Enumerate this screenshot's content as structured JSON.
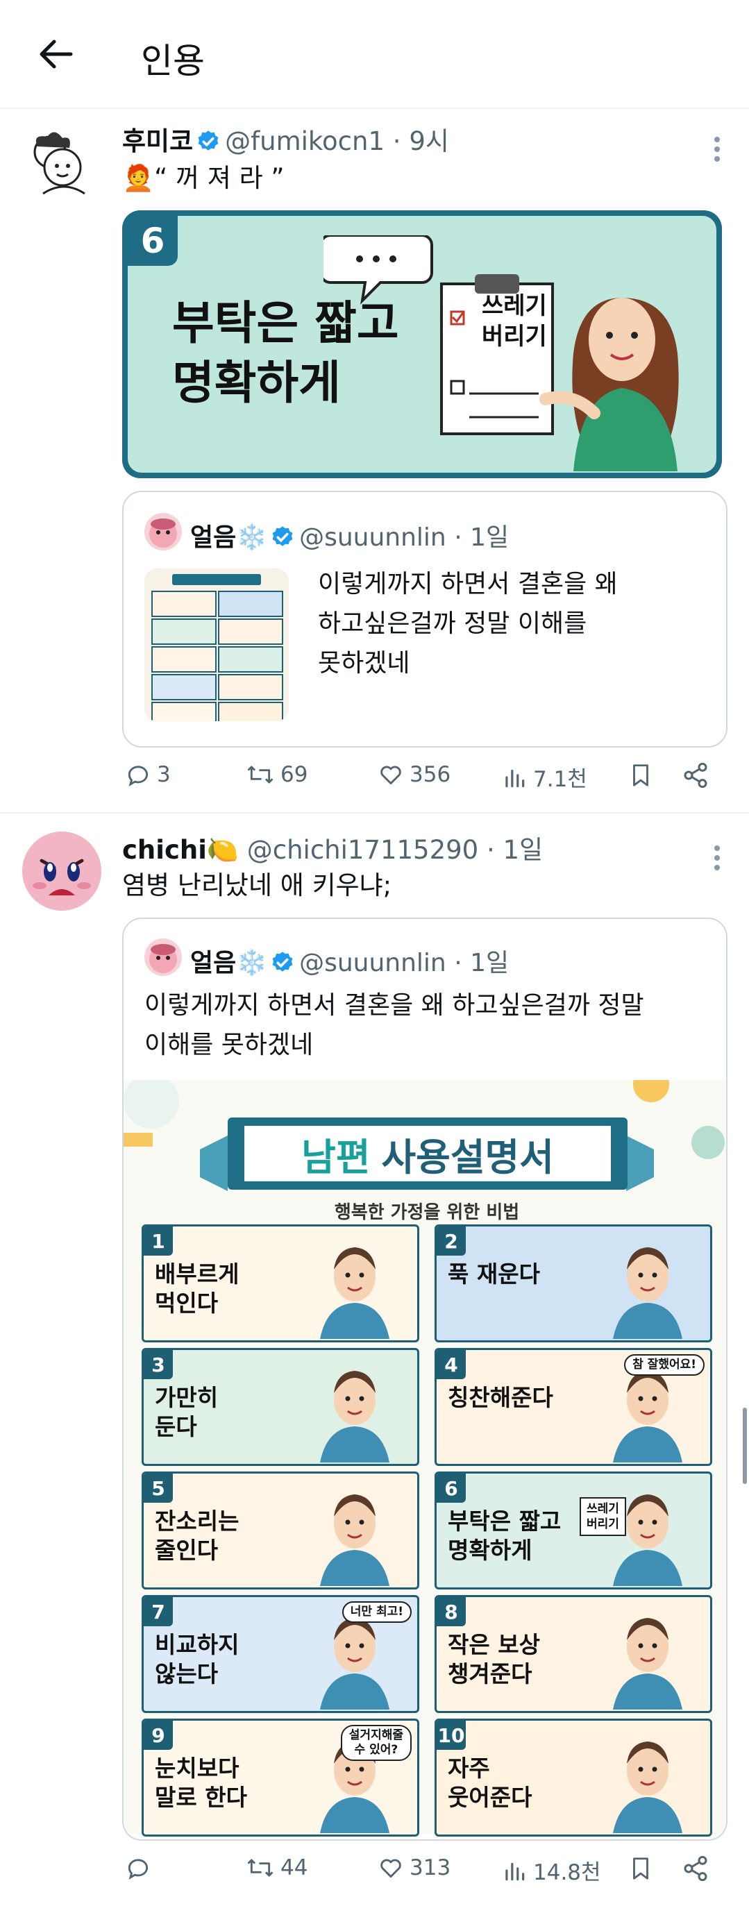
{
  "header": {
    "title": "인용"
  },
  "post1": {
    "display_name": "후미코",
    "handle": "@fumikocn1",
    "time": "9시",
    "text": "🧑‍🦰“ 꺼 져 라 ”",
    "image": {
      "number": "6",
      "line1": "부탁은 짧고",
      "line2": "명확하게",
      "note1": "쓰레기",
      "note2": "버리기"
    },
    "quote": {
      "display_name": "얼음❄️",
      "handle": "@suuunnlin",
      "time": "1일",
      "lines": [
        "이렇게까지 하면서 결혼을 왜",
        "하고싶은걸까 정말 이해를",
        "못하겠네"
      ]
    },
    "actions": {
      "replies": "3",
      "reposts": "69",
      "likes": "356",
      "views": "7.1천"
    }
  },
  "post2": {
    "display_name": "chichi🍋",
    "handle": "@chichi17115290",
    "time": "1일",
    "text": "염병 난리났네 애 키우냐;",
    "quote": {
      "display_name": "얼음❄️",
      "handle": "@suuunnlin",
      "time": "1일",
      "lines": [
        "이렇게까지 하면서 결혼을 왜 하고싶은걸까 정말",
        "이해를 못하겠네"
      ]
    },
    "infographic": {
      "title_accent": "남편",
      "title_main": "사용설명서",
      "subtitle": "행복한 가정을 위한 비법",
      "tiles": [
        {
          "num": "1",
          "text": "배부르게\n먹인다",
          "bg": "#fff7ea"
        },
        {
          "num": "2",
          "text": "푹 재운다",
          "bg": "#cfe3f4"
        },
        {
          "num": "3",
          "text": "가만히\n둔다",
          "bg": "#dff0e4"
        },
        {
          "num": "4",
          "text": "칭찬해준다",
          "bg": "#fff3e3",
          "bubble": "참 잘했어요!"
        },
        {
          "num": "5",
          "text": "잔소리는\n줄인다",
          "bg": "#fff5e6"
        },
        {
          "num": "6",
          "text": "부탁은 짧고\n명확하게",
          "bg": "#dcefe8",
          "note": "쓰레기\n버리기"
        },
        {
          "num": "7",
          "text": "비교하지\n않는다",
          "bg": "#dbeaf6",
          "bubble": "너만 최고!"
        },
        {
          "num": "8",
          "text": "작은 보상\n챙겨준다",
          "bg": "#fff3e4"
        },
        {
          "num": "9",
          "text": "눈치보다\n말로 한다",
          "bg": "#fff7ea",
          "bubble": "설거지해줄\n수 있어?"
        },
        {
          "num": "10",
          "text": "자주\n웃어준다",
          "bg": "#fff2df"
        }
      ]
    },
    "actions": {
      "replies": "",
      "reposts": "44",
      "likes": "313",
      "views": "14.8천"
    }
  }
}
